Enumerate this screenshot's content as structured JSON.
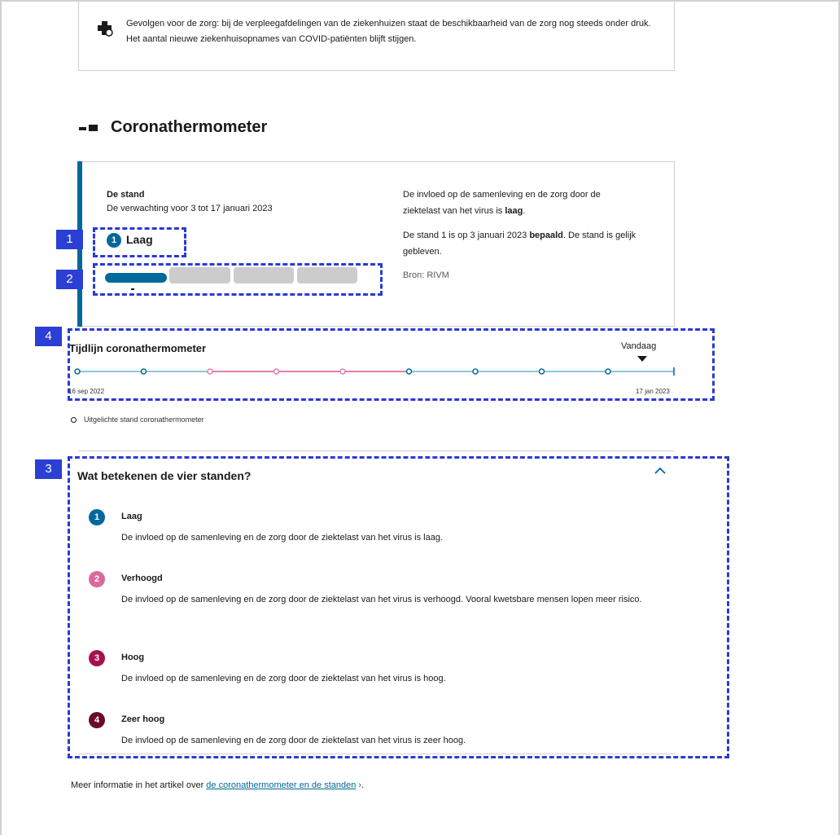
{
  "notice": {
    "icon": "hospital-cross-icon",
    "text": "Gevolgen voor de zorg: bij de verpleegafdelingen van de ziekenhuizen staat de beschikbaarheid van de zorg nog steeds onder druk. Het aantal nieuwe ziekenhuisopnames van COVID-patiënten blijft stijgen."
  },
  "section": {
    "title": "Coronathermometer",
    "icon": "thermometer-icon"
  },
  "status": {
    "label": "De stand",
    "expectation": "De verwachting voor 3 tot 17 januari 2023",
    "level_number": "1",
    "level_name": "Laag",
    "impact_prefix": "De invloed op de samenleving en de zorg door de ziektelast van het virus is ",
    "impact_level": "laag",
    "impact_suffix": ".",
    "decided_prefix": "De stand 1 is op 3 januari 2023 ",
    "decided_bold": "bepaald",
    "decided_suffix": ". De stand is gelijk gebleven.",
    "source": "Bron: RIVM",
    "segments_active": 1,
    "segments_total": 4
  },
  "timeline": {
    "title": "Tijdlijn coronathermometer",
    "today_label": "Vandaag",
    "start_label": "16 sep 2022",
    "end_label": "17 jan 2023",
    "legend": "Uitgelichte stand coronathermometer",
    "points": [
      1,
      1,
      2,
      2,
      2,
      1,
      1,
      1,
      1
    ],
    "colors": {
      "low": "#01689b",
      "elevated": "#e17fa7",
      "track_low": "#8fc6dd"
    }
  },
  "accordion": {
    "title": "Wat betekenen de vier standen?",
    "chevron": "chevron-up-icon",
    "levels": [
      {
        "number": "1",
        "name": "Laag",
        "color": "#01689b",
        "description": "De invloed op de samenleving en de zorg door de ziektelast van het virus is laag."
      },
      {
        "number": "2",
        "name": "Verhoogd",
        "color": "#db6a9b",
        "description": "De invloed op de samenleving en de zorg door de ziektelast van het virus is verhoogd. Vooral kwetsbare mensen lopen meer risico."
      },
      {
        "number": "3",
        "name": "Hoog",
        "color": "#a4124d",
        "description": "De invloed op de samenleving en de zorg door de ziektelast van het virus is hoog."
      },
      {
        "number": "4",
        "name": "Zeer hoog",
        "color": "#6a0a2f",
        "description": "De invloed op de samenleving en de zorg door de ziektelast van het virus is zeer hoog."
      }
    ]
  },
  "annotations": [
    "1",
    "2",
    "3",
    "4"
  ],
  "footer": {
    "prefix": "Meer informatie in het artikel over ",
    "link": "de coronathermometer en de standen",
    "link_suffix": " ›",
    "suffix": "."
  }
}
